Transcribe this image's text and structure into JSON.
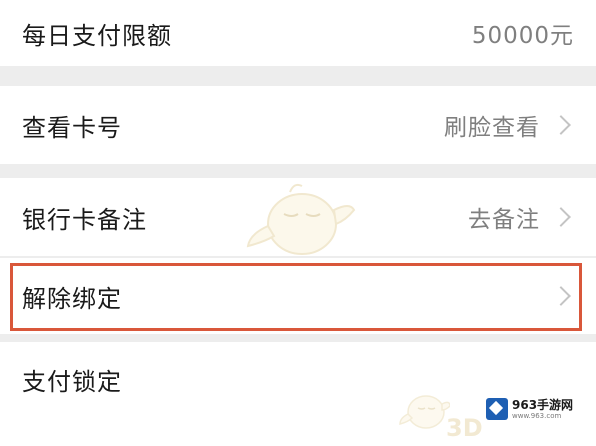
{
  "rows": [
    {
      "label": "每日支付限额",
      "value": "50000元",
      "has_chevron": false
    },
    {
      "label": "查看卡号",
      "value": "刷脸查看",
      "has_chevron": true
    },
    {
      "label": "银行卡备注",
      "value": "去备注",
      "has_chevron": true
    },
    {
      "label": "解除绑定",
      "value": "",
      "has_chevron": true
    },
    {
      "label": "支付锁定",
      "value": "",
      "has_chevron": false
    }
  ],
  "watermark": {
    "brand": "963手游网",
    "domain": "www.963.com",
    "fragment": "3D"
  },
  "colors": {
    "highlight_border": "#d9573a",
    "page_background": "#ededed",
    "logo_blue": "#1e5fb3"
  },
  "icons": [
    "chevron-right-icon",
    "mascot-watermark",
    "logo-icon"
  ]
}
